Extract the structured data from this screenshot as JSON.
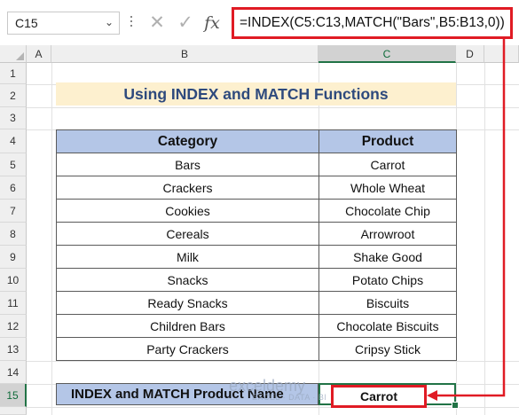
{
  "formula_bar": {
    "name_box": "C15",
    "formula": "=INDEX(C5:C13,MATCH(\"Bars\",B5:B13,0))",
    "fx_label": "fx",
    "cancel_glyph": "✕",
    "enter_glyph": "✓",
    "dropdown_glyph": "⌄"
  },
  "columns": [
    "A",
    "B",
    "C",
    "D"
  ],
  "rows": [
    "1",
    "2",
    "3",
    "4",
    "5",
    "6",
    "7",
    "8",
    "9",
    "10",
    "11",
    "12",
    "13",
    "14",
    "15"
  ],
  "title": "Using INDEX and MATCH Functions",
  "table": {
    "headers": [
      "Category",
      "Product"
    ],
    "rows": [
      [
        "Bars",
        "Carrot"
      ],
      [
        "Crackers",
        "Whole Wheat"
      ],
      [
        "Cookies",
        "Chocolate Chip"
      ],
      [
        "Cereals",
        "Arrowroot"
      ],
      [
        "Milk",
        "Shake Good"
      ],
      [
        "Snacks",
        "Potato Chips"
      ],
      [
        "Ready Snacks",
        "Biscuits"
      ],
      [
        "Children Bars",
        "Chocolate Biscuits"
      ],
      [
        "Party Crackers",
        "Cripsy Stick"
      ]
    ]
  },
  "result": {
    "label": "INDEX and MATCH Product Name",
    "value": "Carrot"
  },
  "watermark": {
    "name": "exceldemy",
    "tagline": "EXCEL · DATA · BI"
  },
  "colors": {
    "highlight": "#e01b24",
    "header_fill": "#b4c6e7",
    "title_fill": "#fdf0cf",
    "selection": "#217346"
  }
}
